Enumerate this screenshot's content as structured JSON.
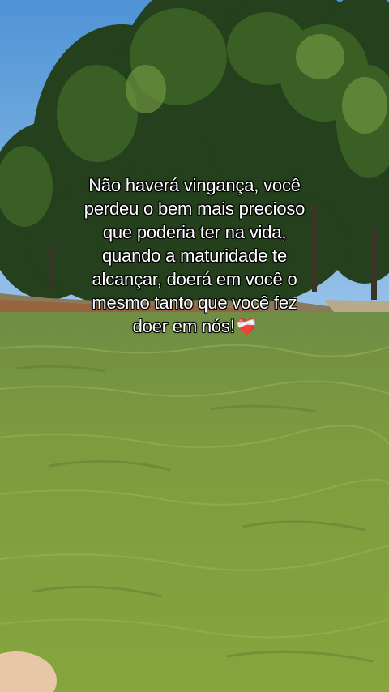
{
  "caption": {
    "lines": [
      "Não haverá vingança, você",
      "perdeu o bem mais precioso",
      "que poderia ter na vida,",
      "quando a maturidade te",
      "alcançar, doerá em você o",
      "mesmo tanto que você fez",
      "doer em nós!"
    ],
    "emoji": "❤️‍🩹",
    "emoji_icon": "mending-heart-icon"
  },
  "colors": {
    "sky": "#6fa8dc",
    "trees_dark": "#1f3b1a",
    "trees_light": "#4f7a2e",
    "water": "#7d9c3e",
    "text": "#ffffff",
    "text_outline": "#000000"
  }
}
